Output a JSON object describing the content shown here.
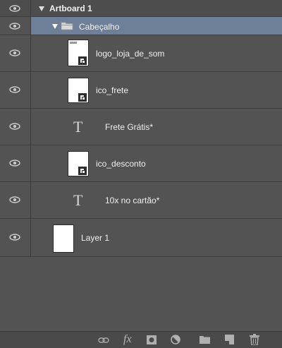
{
  "layers": {
    "artboard": {
      "label": "Artboard 1"
    },
    "group": {
      "label": "Cabeçalho"
    },
    "items": [
      {
        "label": "logo_loja_de_som",
        "kind": "smart-object"
      },
      {
        "label": "ico_frete",
        "kind": "smart-object"
      },
      {
        "label": "Frete Grátis*",
        "kind": "text"
      },
      {
        "label": "ico_desconto",
        "kind": "smart-object"
      },
      {
        "label": "10x no cartão*",
        "kind": "text"
      },
      {
        "label": "Layer 1",
        "kind": "pixel"
      }
    ]
  },
  "toolbar": {
    "fx_label": "fx",
    "icons": [
      "link-layers-icon",
      "fx-icon",
      "mask-icon",
      "adjustment-icon",
      "new-group-icon",
      "new-layer-icon",
      "delete-icon"
    ]
  },
  "colors": {
    "panel_bg": "#535353",
    "selected_bg": "#6e7f98",
    "border": "#3c3c3c"
  }
}
